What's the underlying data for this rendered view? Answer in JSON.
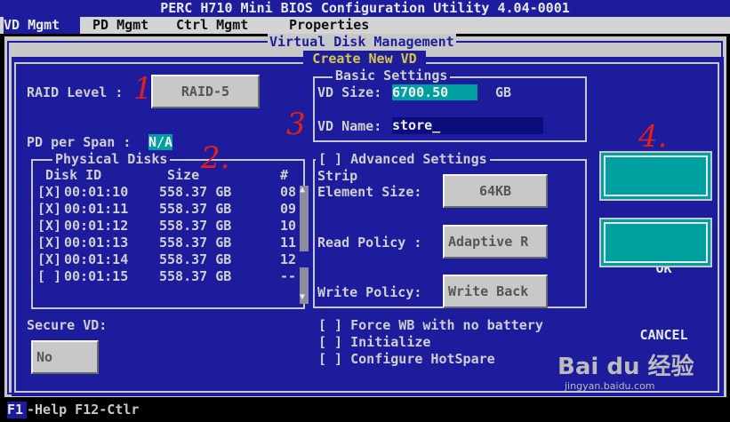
{
  "app": {
    "title": "PERC H710 Mini BIOS Configuration Utility 4.04-0001"
  },
  "menu": {
    "items": [
      {
        "label": "VD Mgmt"
      },
      {
        "label": "PD Mgmt"
      },
      {
        "label": "Ctrl Mgmt"
      },
      {
        "label": "Properties"
      }
    ],
    "active": "VD Mgmt"
  },
  "panel": {
    "title": "Virtual Disk Management"
  },
  "dialog": {
    "title": "Create New VD",
    "raid_level": {
      "label": "RAID Level :",
      "value": "RAID-5"
    },
    "pd_per_span": {
      "label": "PD per Span :",
      "value": "N/A"
    },
    "physical_disks": {
      "title": "Physical Disks",
      "headers": {
        "disk_id": "Disk ID",
        "size": "Size",
        "num": "#"
      },
      "rows": [
        {
          "check": "[X]",
          "disk_id": "00:01:10",
          "size": "558.37 GB",
          "num": "08"
        },
        {
          "check": "[X]",
          "disk_id": "00:01:11",
          "size": "558.37 GB",
          "num": "09"
        },
        {
          "check": "[X]",
          "disk_id": "00:01:12",
          "size": "558.37 GB",
          "num": "10"
        },
        {
          "check": "[X]",
          "disk_id": "00:01:13",
          "size": "558.37 GB",
          "num": "11"
        },
        {
          "check": "[X]",
          "disk_id": "00:01:14",
          "size": "558.37 GB",
          "num": "12"
        },
        {
          "check": "[ ]",
          "disk_id": "00:01:15",
          "size": "558.37 GB",
          "num": "--"
        }
      ]
    },
    "secure_vd": {
      "label": "Secure VD:",
      "value": "No"
    },
    "basic_settings": {
      "title": "Basic Settings",
      "vd_size_label": "VD Size:",
      "vd_size_value": "6700.50",
      "vd_size_unit": "GB",
      "vd_name_label": "VD Name:",
      "vd_name_value": "store_"
    },
    "advanced": {
      "title": "[ ] Advanced Settings",
      "strip_label_1": "Strip",
      "strip_label_2": "Element Size:",
      "strip_value": "64KB",
      "read_policy_label": "Read Policy :",
      "read_policy_value": "Adaptive R",
      "write_policy_label": "Write Policy:",
      "write_policy_value": "Write Back",
      "options": [
        {
          "label": "[ ] Force WB with no battery"
        },
        {
          "label": "[ ] Initialize"
        },
        {
          "label": "[ ] Configure HotSpare"
        }
      ]
    },
    "ok_label": "OK",
    "cancel_label": "CANCEL"
  },
  "status": {
    "key": "F1",
    "text": "-Help F12-Ctlr"
  },
  "annotations": [
    "1",
    "2.",
    "3",
    "4."
  ],
  "watermark": {
    "text": "Bai du 经验",
    "url": "jingyan.baidu.com"
  },
  "colors": {
    "bios_blue": "#1c1c9c",
    "panel_gray": "#c8c8c8",
    "teal": "#00a0a0",
    "title_yellow": "#d8c84a",
    "highlight_cyan": "#00a0a0"
  }
}
